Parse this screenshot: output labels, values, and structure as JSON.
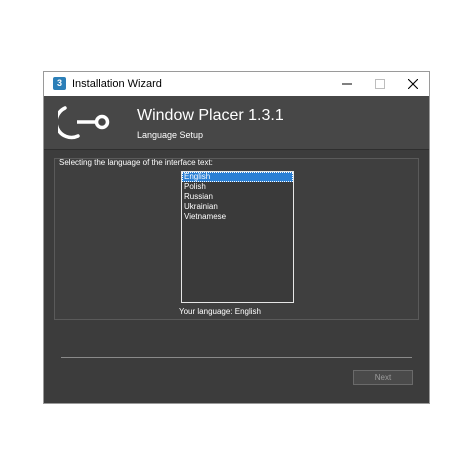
{
  "window": {
    "title": "Installation Wizard",
    "icon_label": "3"
  },
  "titlebar_buttons": {
    "minimize": "minimize-icon",
    "maximize": "maximize-icon",
    "close": "close-icon"
  },
  "header": {
    "app_title": "Window Placer 1.3.1",
    "subtitle": "Language Setup",
    "logo": "node-link-logo"
  },
  "language_group": {
    "label": "Selecting the language of the interface text:",
    "options": [
      "English",
      "Polish",
      "Russian",
      "Ukrainian",
      "Vietnamese"
    ],
    "selected": "English",
    "status": "Your language: English"
  },
  "footer": {
    "next_label": "Next"
  },
  "colors": {
    "window_bg": "#474747",
    "selection": "#2a7fd4",
    "text": "#ffffff"
  }
}
